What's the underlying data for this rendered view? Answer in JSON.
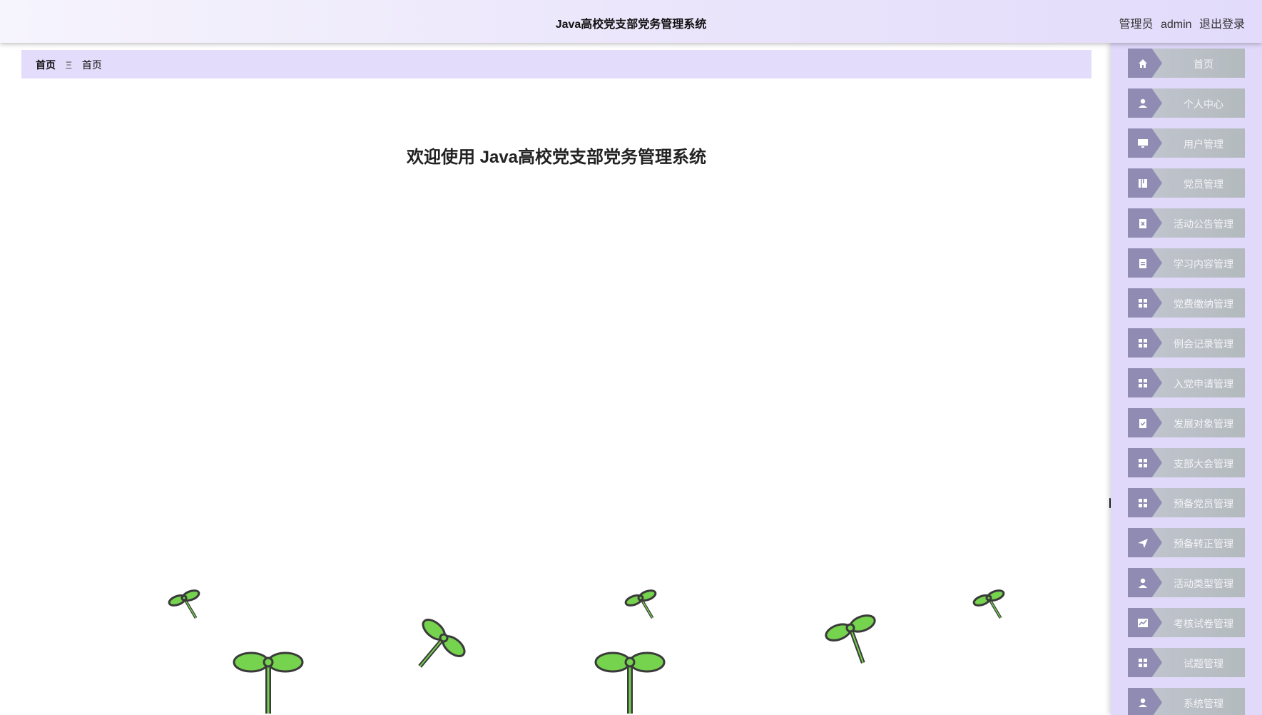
{
  "header": {
    "title": "Java高校党支部党务管理系统",
    "role": "管理员",
    "username": "admin",
    "logout_label": "退出登录"
  },
  "breadcrumb": {
    "root": "首页",
    "separator": "Ξ",
    "current": "首页"
  },
  "main": {
    "welcome": "欢迎使用 Java高校党支部党务管理系统"
  },
  "sidebar": {
    "items": [
      {
        "label": "首页",
        "icon": "home-icon"
      },
      {
        "label": "个人中心",
        "icon": "user-icon"
      },
      {
        "label": "用户管理",
        "icon": "monitor-icon"
      },
      {
        "label": "党员管理",
        "icon": "book-icon"
      },
      {
        "label": "活动公告管理",
        "icon": "clipboard-x-icon"
      },
      {
        "label": "学习内容管理",
        "icon": "clipboard-icon"
      },
      {
        "label": "党费缴纳管理",
        "icon": "grid-icon"
      },
      {
        "label": "例会记录管理",
        "icon": "grid-icon"
      },
      {
        "label": "入党申请管理",
        "icon": "grid-icon"
      },
      {
        "label": "发展对象管理",
        "icon": "clipboard-check-icon"
      },
      {
        "label": "支部大会管理",
        "icon": "grid-icon"
      },
      {
        "label": "预备党员管理",
        "icon": "grid-icon"
      },
      {
        "label": "预备转正管理",
        "icon": "send-icon"
      },
      {
        "label": "活动类型管理",
        "icon": "person-icon"
      },
      {
        "label": "考核试卷管理",
        "icon": "chart-icon"
      },
      {
        "label": "试题管理",
        "icon": "grid-icon"
      },
      {
        "label": "系统管理",
        "icon": "user-icon"
      }
    ]
  },
  "colors": {
    "accent": "#e3dcfa",
    "menu_tab": "#8f8bb3",
    "menu_bg": "#c3c7d2",
    "sprout_green": "#76d34e",
    "sprout_outline": "#3a3a3a"
  }
}
